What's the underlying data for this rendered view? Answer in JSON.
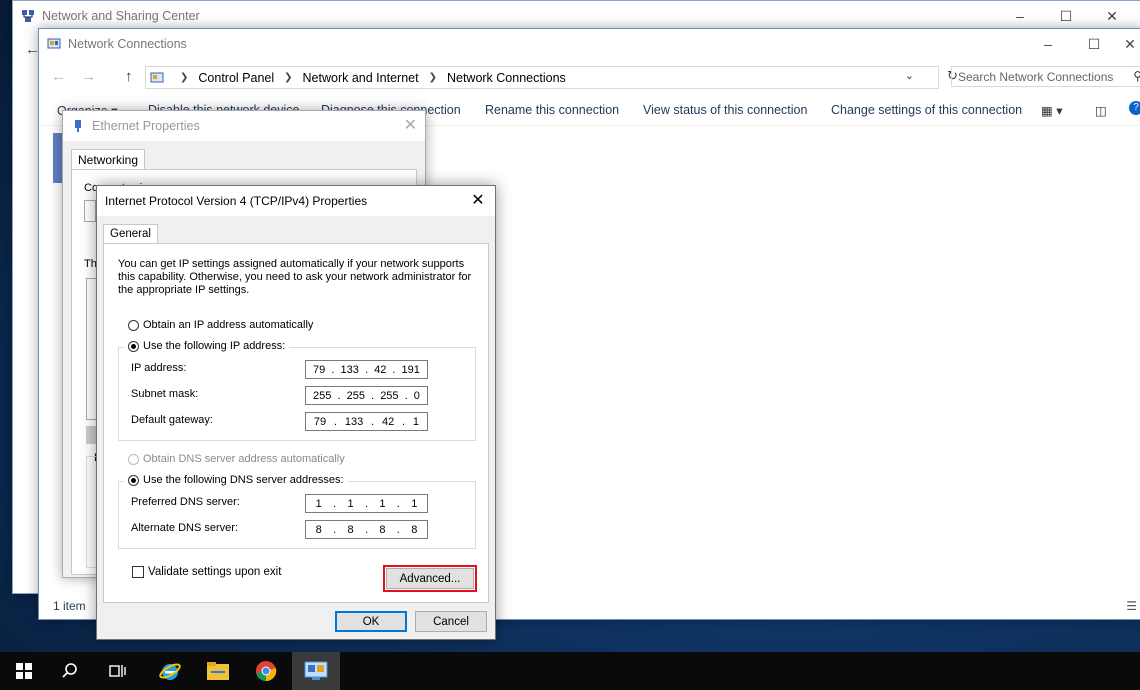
{
  "windows": {
    "nsc": {
      "title": "Network and Sharing Center"
    },
    "nc": {
      "title": "Network Connections",
      "breadcrumb": [
        "Control Panel",
        "Network and Internet",
        "Network Connections"
      ],
      "search_placeholder": "Search Network Connections",
      "commands": [
        "Organize ▾",
        "Disable this network device",
        "Diagnose this connection",
        "Rename this connection",
        "View status of this connection",
        "Change settings of this connection"
      ],
      "status": "1 item"
    },
    "eth": {
      "title": "Ethernet Properties",
      "tab": "Networking",
      "partial_labels": [
        "Connect using:",
        "Th",
        "D"
      ]
    },
    "ipv4": {
      "title": "Internet Protocol Version 4 (TCP/IPv4) Properties",
      "tab": "General",
      "intro": "You can get IP settings assigned automatically if your network supports this capability. Otherwise, you need to ask your network administrator for the appropriate IP settings.",
      "ip_auto_label": "Obtain an IP address automatically",
      "ip_manual_label": "Use the following IP address:",
      "ip_mode": "manual",
      "fields": {
        "ip": {
          "label": "IP address:",
          "octets": [
            "79",
            "133",
            "42",
            "191"
          ]
        },
        "mask": {
          "label": "Subnet mask:",
          "octets": [
            "255",
            "255",
            "255",
            "0"
          ]
        },
        "gateway": {
          "label": "Default gateway:",
          "octets": [
            "79",
            "133",
            "42",
            "1"
          ]
        },
        "dns1": {
          "label": "Preferred DNS server:",
          "octets": [
            "1",
            "1",
            "1",
            "1"
          ]
        },
        "dns2": {
          "label": "Alternate DNS server:",
          "octets": [
            "8",
            "8",
            "8",
            "8"
          ]
        }
      },
      "dns_auto_label": "Obtain DNS server address automatically",
      "dns_manual_label": "Use the following DNS server addresses:",
      "dns_mode": "manual",
      "validate_label": "Validate settings upon exit",
      "validate_checked": false,
      "advanced_label": "Advanced...",
      "ok_label": "OK",
      "cancel_label": "Cancel"
    }
  },
  "taskbar": {
    "items": [
      "start-icon",
      "search-icon",
      "task-view-icon",
      "internet-explorer-icon",
      "file-explorer-icon",
      "chrome-icon",
      "network-connections-icon"
    ]
  },
  "colors": {
    "accent": "#0078d7",
    "highlight": "#e0101c",
    "link": "#1e395b"
  }
}
